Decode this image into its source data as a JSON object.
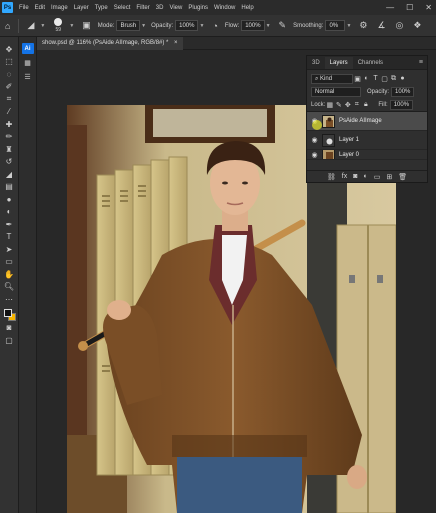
{
  "menubar": {
    "logo": "Ps",
    "items": [
      "File",
      "Edit",
      "Image",
      "Layer",
      "Type",
      "Select",
      "Filter",
      "3D",
      "View",
      "Plugins",
      "Window",
      "Help"
    ],
    "window_controls": [
      "—",
      "☐",
      "✕"
    ]
  },
  "options": {
    "brush_size": "59",
    "mode_label": "Mode:",
    "mode_value": "Brush",
    "opacity_label": "Opacity:",
    "opacity_value": "100%",
    "flow_label": "Flow:",
    "flow_value": "100%",
    "smoothing_label": "Smoothing:",
    "smoothing_value": "0%"
  },
  "strip": {
    "active_label": "Ai"
  },
  "document": {
    "tab_title": "show.psd @ 116% (PsAide AIImage, RGB/8#) *",
    "close": "×"
  },
  "layers_panel": {
    "tabs": [
      "3D",
      "Layers",
      "Channels"
    ],
    "kind_label": "Kind",
    "blend_mode": "Normal",
    "opacity_label": "Opacity:",
    "opacity_value": "100%",
    "lock_label": "Lock:",
    "fill_label": "Fill:",
    "fill_value": "100%",
    "layers": [
      {
        "name": "PsAide AIImage",
        "selected": true
      },
      {
        "name": "Layer 1",
        "selected": false
      },
      {
        "name": "Layer 0",
        "selected": false
      }
    ],
    "footer_icons": [
      "link-icon",
      "fx-icon",
      "mask-icon",
      "adjustment-icon",
      "folder-icon",
      "new-layer-icon",
      "trash-icon"
    ]
  },
  "colors": {
    "foreground": "#111111",
    "background": "#f5b400",
    "accent": "#31a8ff"
  }
}
